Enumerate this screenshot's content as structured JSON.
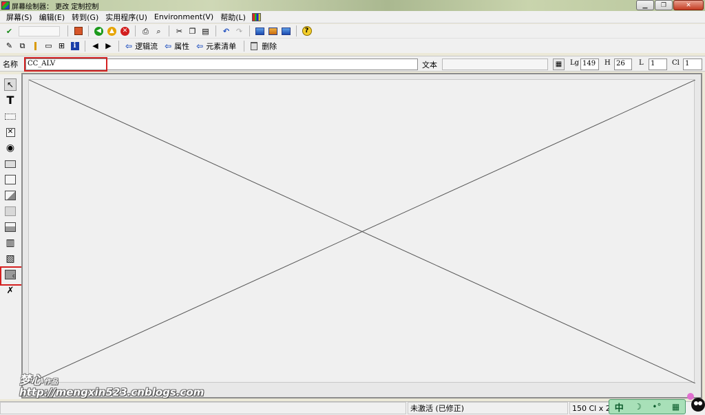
{
  "window": {
    "title": "屏幕绘制器： 更改 定制控制",
    "controls": {
      "minimize": "▁",
      "maximize": "❐",
      "close": "✕"
    }
  },
  "menu": [
    "屏幕(S)",
    "编辑(E)",
    "转到(G)",
    "实用程序(U)",
    "Environment(V)",
    "帮助(L)"
  ],
  "toolbar2": {
    "flow_logic": "逻辑流",
    "attributes": "属性",
    "element_list": "元素清单",
    "delete": "删除"
  },
  "attributes": {
    "name_label": "名称",
    "name_value": "CC_ALV",
    "text_label": "文本",
    "text_value": "",
    "lg_label": "Lg",
    "lg_value": "149",
    "h_label": "H",
    "h_value": "26",
    "l_label": "L",
    "l_value": "1",
    "cl_label": "Cl",
    "cl_value": "1"
  },
  "palette": [
    "select-pointer",
    "text-field",
    "input-field",
    "checkbox",
    "radio-button",
    "pushbutton",
    "tabstrip",
    "tabstrip-wizard",
    "box",
    "subscreen",
    "table-control",
    "table-control-wizard",
    "custom-control",
    "status-icon"
  ],
  "status": {
    "mode": "未激活 (已修正)",
    "size": "150 Cl x 26"
  },
  "watermark": {
    "name": "梦心",
    "sub": "作品",
    "url": "http://mengxin523.cnblogs.com"
  },
  "ime": {
    "lang": "中",
    "moon": "☽",
    "dots": "•°",
    "kbd": "▦"
  },
  "colors": {
    "highlight": "#d42020",
    "ime": "#a8e0b8"
  }
}
